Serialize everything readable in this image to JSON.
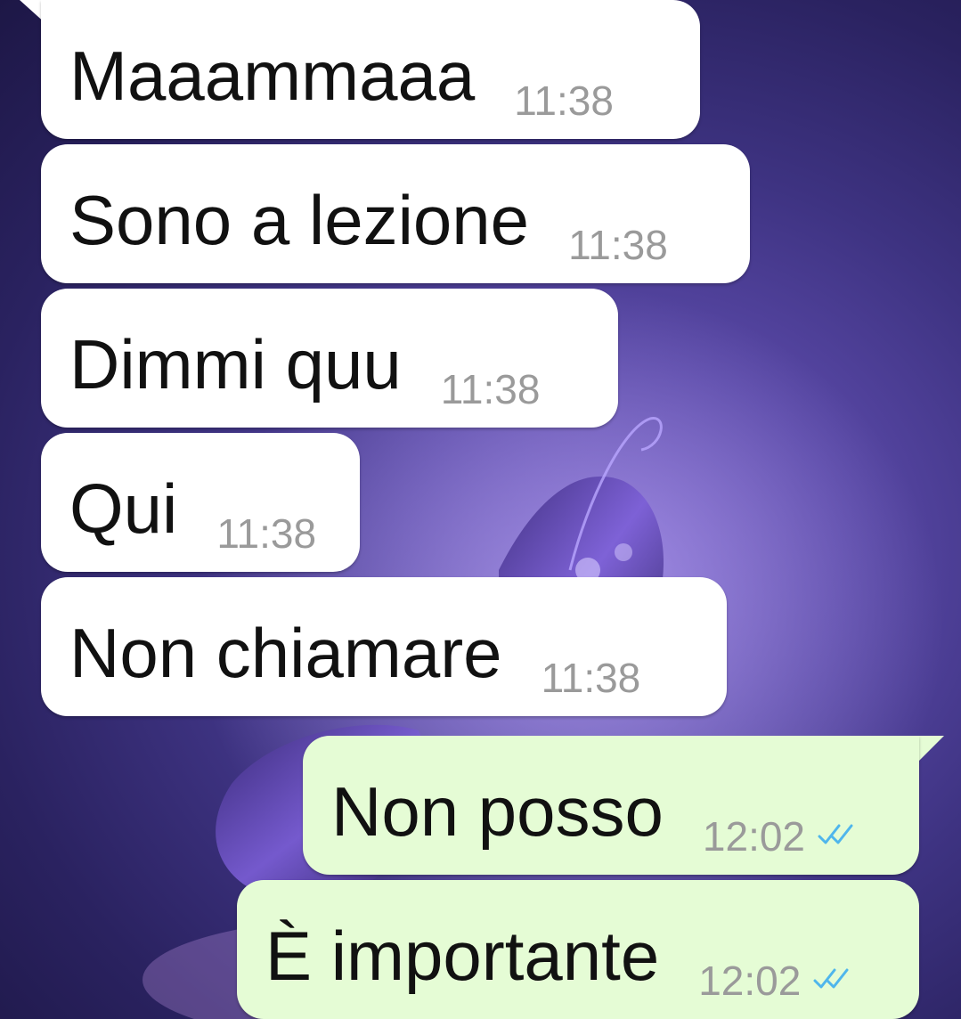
{
  "chat": {
    "messages": [
      {
        "direction": "incoming",
        "text": "Maaammaaa",
        "time": "11:38"
      },
      {
        "direction": "incoming",
        "text": "Sono a lezione",
        "time": "11:38"
      },
      {
        "direction": "incoming",
        "text": "Dimmi quu",
        "time": "11:38"
      },
      {
        "direction": "incoming",
        "text": "Qui",
        "time": "11:38"
      },
      {
        "direction": "incoming",
        "text": "Non chiamare",
        "time": "11:38"
      },
      {
        "direction": "outgoing",
        "text": "Non posso",
        "time": "12:02",
        "status": "read",
        "status_icon": "double-check-icon"
      },
      {
        "direction": "outgoing",
        "text": "È importante",
        "time": "12:02",
        "status": "read",
        "status_icon": "double-check-icon"
      }
    ]
  },
  "colors": {
    "incoming_bubble": "#ffffff",
    "outgoing_bubble": "#e5fcd5",
    "timestamp": "#9a9a9a",
    "read_ticks": "#4fb6ec",
    "wallpaper": "#3e3382"
  },
  "wallpaper": {
    "icon": "butterfly-wallpaper-icon"
  }
}
